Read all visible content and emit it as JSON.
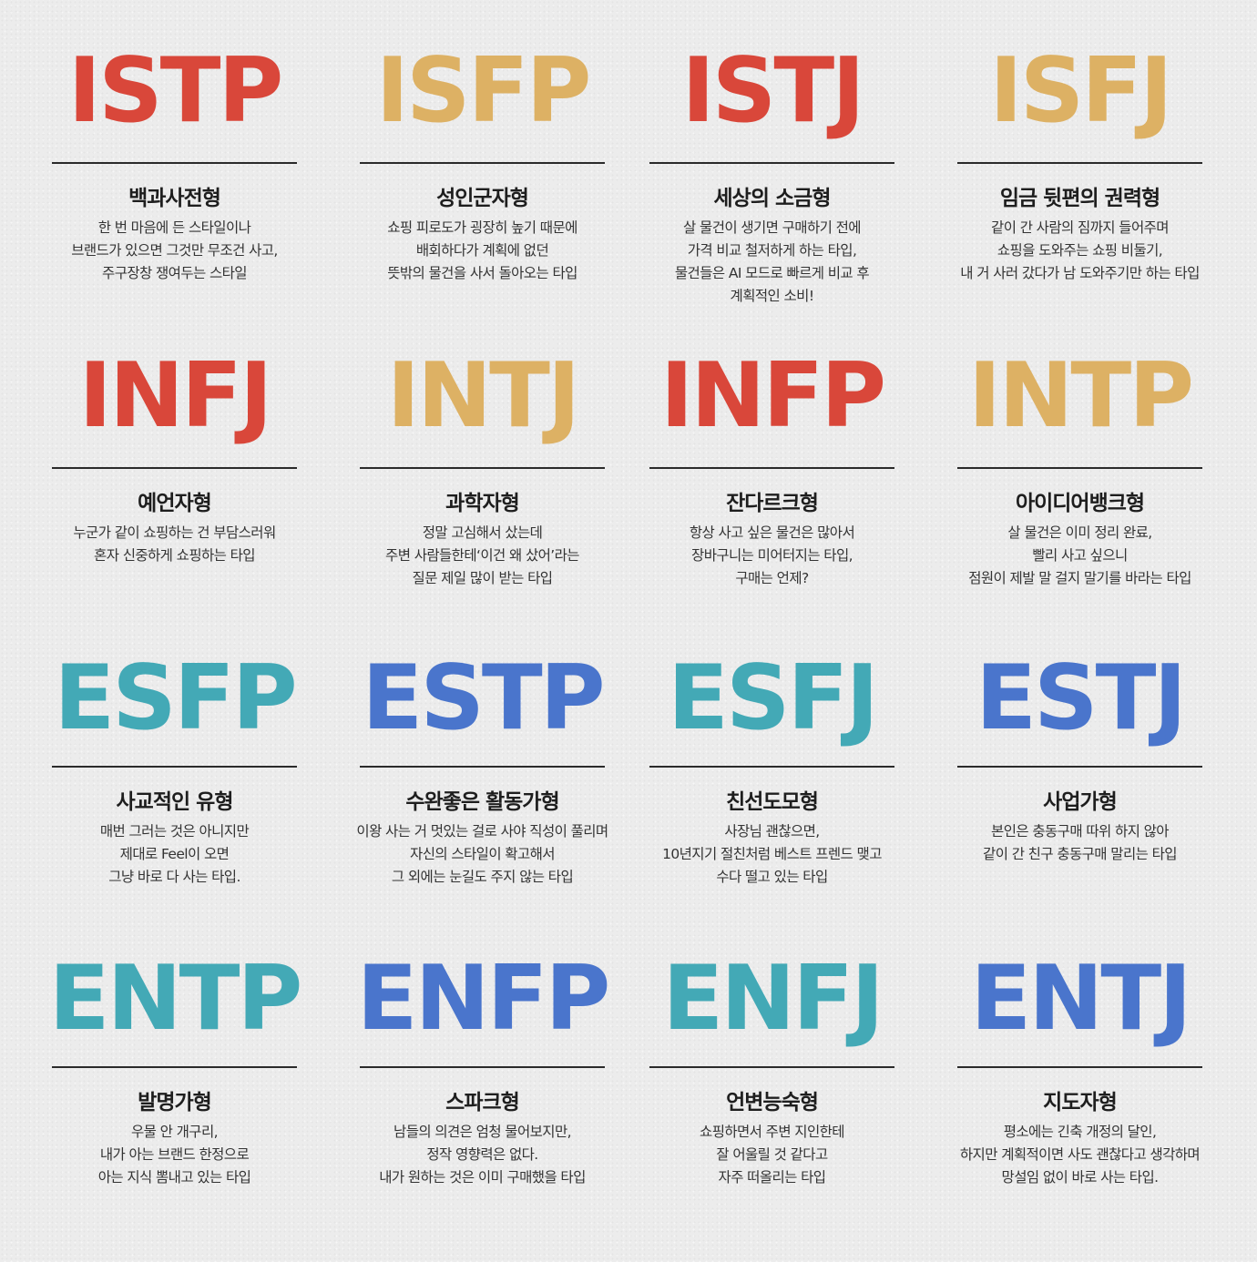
{
  "colors": {
    "red": "#d9473a",
    "gold": "#ddb164",
    "teal": "#43a9b6",
    "blue": "#4a75cc"
  },
  "types": [
    {
      "code": "ISTP",
      "color": "red",
      "name": "백과사전형",
      "lines": [
        "한 번 마음에 든 스타일이나",
        "브랜드가 있으면 그것만 무조건 사고,",
        "주구장창 쟁여두는 스타일"
      ]
    },
    {
      "code": "ISFP",
      "color": "gold",
      "name": "성인군자형",
      "lines": [
        "쇼핑 피로도가 굉장히 높기 때문에",
        "배회하다가 계획에 없던",
        "뜻밖의 물건을 사서 돌아오는 타입"
      ]
    },
    {
      "code": "ISTJ",
      "color": "red",
      "name": "세상의 소금형",
      "lines": [
        "살 물건이 생기면 구매하기 전에",
        "가격 비교 철저하게 하는 타입,",
        "물건들은 AI 모드로 빠르게 비교 후",
        "계획적인 소비!"
      ]
    },
    {
      "code": "ISFJ",
      "color": "gold",
      "name": "임금 뒷편의 권력형",
      "lines": [
        "같이 간 사람의 짐까지 들어주며",
        "쇼핑을 도와주는 쇼핑 비둘기,",
        "내 거 사러 갔다가 남 도와주기만 하는 타입"
      ]
    },
    {
      "code": "INFJ",
      "color": "red",
      "name": "예언자형",
      "lines": [
        "누군가 같이 쇼핑하는 건 부담스러워",
        "혼자 신중하게 쇼핑하는 타입"
      ]
    },
    {
      "code": "INTJ",
      "color": "gold",
      "name": "과학자형",
      "lines": [
        "정말 고심해서 샀는데",
        "주변 사람들한테‘이건 왜 샀어’라는",
        "질문 제일 많이 받는 타입"
      ]
    },
    {
      "code": "INFP",
      "color": "red",
      "name": "잔다르크형",
      "lines": [
        "항상 사고 싶은 물건은 많아서",
        "장바구니는 미어터지는 타입,",
        "구매는 언제?"
      ]
    },
    {
      "code": "INTP",
      "color": "gold",
      "name": "아이디어뱅크형",
      "lines": [
        "살 물건은 이미 정리 완료,",
        "빨리 사고 싶으니",
        "점원이 제발 말 걸지 말기를 바라는 타입"
      ]
    },
    {
      "code": "ESFP",
      "color": "teal",
      "name": "사교적인 유형",
      "lines": [
        "매번 그러는 것은 아니지만",
        "제대로 Feel이 오면",
        "그냥 바로 다 사는 타입."
      ]
    },
    {
      "code": "ESTP",
      "color": "blue",
      "name": "수완좋은 활동가형",
      "lines": [
        "이왕 사는 거 멋있는 걸로 사야 직성이 풀리며",
        "자신의 스타일이 확고해서",
        "그 외에는 눈길도 주지 않는 타입"
      ]
    },
    {
      "code": "ESFJ",
      "color": "teal",
      "name": "친선도모형",
      "lines": [
        "사장님 괜찮으면,",
        "10년지기 절친처럼 베스트 프렌드 맺고",
        "수다 떨고 있는 타입"
      ]
    },
    {
      "code": "ESTJ",
      "color": "blue",
      "name": "사업가형",
      "lines": [
        "본인은 충동구매 따위 하지 않아",
        "같이 간 친구 충동구매 말리는 타입"
      ]
    },
    {
      "code": "ENTP",
      "color": "teal",
      "name": "발명가형",
      "lines": [
        "우물 안 개구리,",
        "내가 아는 브랜드 한정으로",
        "아는 지식 뽐내고 있는 타입"
      ]
    },
    {
      "code": "ENFP",
      "color": "blue",
      "name": "스파크형",
      "lines": [
        "남들의 의견은 엄청 물어보지만,",
        "정작 영향력은 없다.",
        "내가 원하는 것은 이미 구매했을 타입"
      ]
    },
    {
      "code": "ENFJ",
      "color": "teal",
      "name": "언변능숙형",
      "lines": [
        "쇼핑하면서 주변 지인한테",
        "잘 어울릴 것 같다고",
        "자주 떠올리는 타입"
      ]
    },
    {
      "code": "ENTJ",
      "color": "blue",
      "name": "지도자형",
      "lines": [
        "평소에는 긴축 개정의 달인,",
        "하지만 계획적이면 사도 괜찮다고 생각하며",
        "망설임 없이 바로 사는 타입."
      ]
    }
  ]
}
